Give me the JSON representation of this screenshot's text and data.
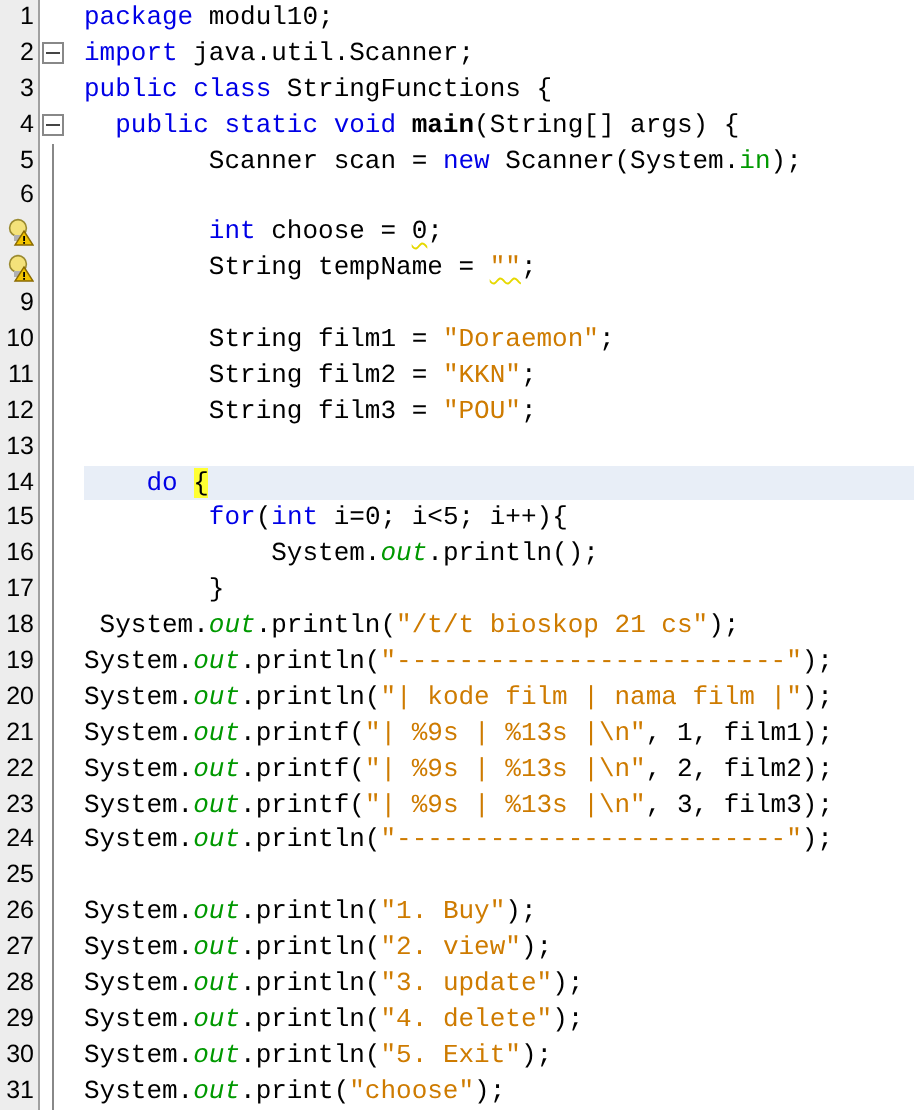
{
  "lines": [
    {
      "number": "1",
      "warning": false,
      "collapsible": false,
      "in_block": false,
      "current": false,
      "tokens": [
        {
          "text": "package",
          "kind": "keyword"
        },
        {
          "text": " modul10;",
          "kind": "plain"
        }
      ]
    },
    {
      "number": "2",
      "warning": false,
      "collapsible": true,
      "in_block": false,
      "current": false,
      "tokens": [
        {
          "text": "import",
          "kind": "keyword"
        },
        {
          "text": " java.util.Scanner;",
          "kind": "plain"
        }
      ]
    },
    {
      "number": "3",
      "warning": false,
      "collapsible": false,
      "in_block": false,
      "current": false,
      "tokens": [
        {
          "text": "public class",
          "kind": "keyword"
        },
        {
          "text": " StringFunctions {",
          "kind": "plain"
        }
      ]
    },
    {
      "number": "4",
      "warning": false,
      "collapsible": true,
      "in_block": false,
      "current": false,
      "tokens": [
        {
          "text": "  public static void ",
          "kind": "keyword"
        },
        {
          "text": "main",
          "kind": "method"
        },
        {
          "text": "(String[] args) {",
          "kind": "plain"
        }
      ]
    },
    {
      "number": "5",
      "warning": false,
      "collapsible": false,
      "in_block": true,
      "current": false,
      "tokens": [
        {
          "text": "        Scanner scan = ",
          "kind": "plain"
        },
        {
          "text": "new",
          "kind": "keyword"
        },
        {
          "text": " Scanner(System.",
          "kind": "plain"
        },
        {
          "text": "in",
          "kind": "field"
        },
        {
          "text": ");",
          "kind": "plain"
        }
      ]
    },
    {
      "number": "6",
      "warning": false,
      "collapsible": false,
      "in_block": true,
      "current": false
    },
    {
      "warning": true,
      "collapsible": false,
      "in_block": true,
      "current": false,
      "tokens": [
        {
          "text": "        int",
          "kind": "keyword"
        },
        {
          "text": " choose = ",
          "kind": "plain"
        },
        {
          "text": "0",
          "kind": "plain",
          "warn": true
        },
        {
          "text": ";",
          "kind": "plain"
        }
      ]
    },
    {
      "warning": true,
      "collapsible": false,
      "in_block": true,
      "current": false,
      "tokens": [
        {
          "text": "        String tempName = ",
          "kind": "plain"
        },
        {
          "text": "\"\"",
          "kind": "string",
          "warn": true
        },
        {
          "text": ";",
          "kind": "plain"
        }
      ]
    },
    {
      "number": "9",
      "warning": false,
      "collapsible": false,
      "in_block": true,
      "current": false
    },
    {
      "number": "10",
      "warning": false,
      "collapsible": false,
      "in_block": true,
      "current": false,
      "tokens": [
        {
          "text": "        String film1 = ",
          "kind": "plain"
        },
        {
          "text": "\"Doraemon\"",
          "kind": "string"
        },
        {
          "text": ";",
          "kind": "plain"
        }
      ]
    },
    {
      "number": "11",
      "warning": false,
      "collapsible": false,
      "in_block": true,
      "current": false,
      "tokens": [
        {
          "text": "        String film2 = ",
          "kind": "plain"
        },
        {
          "text": "\"KKN\"",
          "kind": "string"
        },
        {
          "text": ";",
          "kind": "plain"
        }
      ]
    },
    {
      "number": "12",
      "warning": false,
      "collapsible": false,
      "in_block": true,
      "current": false,
      "tokens": [
        {
          "text": "        String film3 = ",
          "kind": "plain"
        },
        {
          "text": "\"POU\"",
          "kind": "string"
        },
        {
          "text": ";",
          "kind": "plain"
        }
      ]
    },
    {
      "number": "13",
      "warning": false,
      "collapsible": false,
      "in_block": true,
      "current": false
    },
    {
      "number": "14",
      "warning": false,
      "collapsible": false,
      "in_block": true,
      "current": true,
      "tokens": [
        {
          "text": "    do ",
          "kind": "keyword"
        },
        {
          "text": "{",
          "kind": "plain",
          "matched": true
        }
      ]
    },
    {
      "number": "15",
      "warning": false,
      "collapsible": false,
      "in_block": true,
      "current": false,
      "tokens": [
        {
          "text": "        for",
          "kind": "keyword"
        },
        {
          "text": "(",
          "kind": "plain"
        },
        {
          "text": "int",
          "kind": "keyword"
        },
        {
          "text": " i=0; i<5; i++){",
          "kind": "plain"
        }
      ]
    },
    {
      "number": "16",
      "warning": false,
      "collapsible": false,
      "in_block": true,
      "current": false,
      "tokens": [
        {
          "text": "            System.",
          "kind": "plain"
        },
        {
          "text": "out",
          "kind": "static"
        },
        {
          "text": ".println();",
          "kind": "plain"
        }
      ]
    },
    {
      "number": "17",
      "warning": false,
      "collapsible": false,
      "in_block": true,
      "current": false,
      "tokens": [
        {
          "text": "        }",
          "kind": "plain"
        }
      ]
    },
    {
      "number": "18",
      "warning": false,
      "collapsible": false,
      "in_block": true,
      "current": false,
      "tokens": [
        {
          "text": " System.",
          "kind": "plain"
        },
        {
          "text": "out",
          "kind": "static"
        },
        {
          "text": ".println(",
          "kind": "plain"
        },
        {
          "text": "\"/t/t bioskop 21 cs\"",
          "kind": "string"
        },
        {
          "text": ");",
          "kind": "plain"
        }
      ]
    },
    {
      "number": "19",
      "warning": false,
      "collapsible": false,
      "in_block": true,
      "current": false,
      "tokens": [
        {
          "text": "System.",
          "kind": "plain"
        },
        {
          "text": "out",
          "kind": "static"
        },
        {
          "text": ".println(",
          "kind": "plain"
        },
        {
          "text": "\"-------------------------\"",
          "kind": "string"
        },
        {
          "text": ");",
          "kind": "plain"
        }
      ]
    },
    {
      "number": "20",
      "warning": false,
      "collapsible": false,
      "in_block": true,
      "current": false,
      "tokens": [
        {
          "text": "System.",
          "kind": "plain"
        },
        {
          "text": "out",
          "kind": "static"
        },
        {
          "text": ".println(",
          "kind": "plain"
        },
        {
          "text": "\"| kode film | nama film |\"",
          "kind": "string"
        },
        {
          "text": ");",
          "kind": "plain"
        }
      ]
    },
    {
      "number": "21",
      "warning": false,
      "collapsible": false,
      "in_block": true,
      "current": false,
      "tokens": [
        {
          "text": "System.",
          "kind": "plain"
        },
        {
          "text": "out",
          "kind": "static"
        },
        {
          "text": ".printf(",
          "kind": "plain"
        },
        {
          "text": "\"| %9s | %13s |\\n\"",
          "kind": "string"
        },
        {
          "text": ", 1, film1);",
          "kind": "plain"
        }
      ]
    },
    {
      "number": "22",
      "warning": false,
      "collapsible": false,
      "in_block": true,
      "current": false,
      "tokens": [
        {
          "text": "System.",
          "kind": "plain"
        },
        {
          "text": "out",
          "kind": "static"
        },
        {
          "text": ".printf(",
          "kind": "plain"
        },
        {
          "text": "\"| %9s | %13s |\\n\"",
          "kind": "string"
        },
        {
          "text": ", 2, film2);",
          "kind": "plain"
        }
      ]
    },
    {
      "number": "23",
      "warning": false,
      "collapsible": false,
      "in_block": true,
      "current": false,
      "tokens": [
        {
          "text": "System.",
          "kind": "plain"
        },
        {
          "text": "out",
          "kind": "static"
        },
        {
          "text": ".printf(",
          "kind": "plain"
        },
        {
          "text": "\"| %9s | %13s |\\n\"",
          "kind": "string"
        },
        {
          "text": ", 3, film3);",
          "kind": "plain"
        }
      ]
    },
    {
      "number": "24",
      "warning": false,
      "collapsible": false,
      "in_block": true,
      "current": false,
      "tokens": [
        {
          "text": "System.",
          "kind": "plain"
        },
        {
          "text": "out",
          "kind": "static"
        },
        {
          "text": ".println(",
          "kind": "plain"
        },
        {
          "text": "\"-------------------------\"",
          "kind": "string"
        },
        {
          "text": ");",
          "kind": "plain"
        }
      ]
    },
    {
      "number": "25",
      "warning": false,
      "collapsible": false,
      "in_block": true,
      "current": false
    },
    {
      "number": "26",
      "warning": false,
      "collapsible": false,
      "in_block": true,
      "current": false,
      "tokens": [
        {
          "text": "System.",
          "kind": "plain"
        },
        {
          "text": "out",
          "kind": "static"
        },
        {
          "text": ".println(",
          "kind": "plain"
        },
        {
          "text": "\"1. Buy\"",
          "kind": "string"
        },
        {
          "text": ");",
          "kind": "plain"
        }
      ]
    },
    {
      "number": "27",
      "warning": false,
      "collapsible": false,
      "in_block": true,
      "current": false,
      "tokens": [
        {
          "text": "System.",
          "kind": "plain"
        },
        {
          "text": "out",
          "kind": "static"
        },
        {
          "text": ".println(",
          "kind": "plain"
        },
        {
          "text": "\"2. view\"",
          "kind": "string"
        },
        {
          "text": ");",
          "kind": "plain"
        }
      ]
    },
    {
      "number": "28",
      "warning": false,
      "collapsible": false,
      "in_block": true,
      "current": false,
      "tokens": [
        {
          "text": "System.",
          "kind": "plain"
        },
        {
          "text": "out",
          "kind": "static"
        },
        {
          "text": ".println(",
          "kind": "plain"
        },
        {
          "text": "\"3. update\"",
          "kind": "string"
        },
        {
          "text": ");",
          "kind": "plain"
        }
      ]
    },
    {
      "number": "29",
      "warning": false,
      "collapsible": false,
      "in_block": true,
      "current": false,
      "tokens": [
        {
          "text": "System.",
          "kind": "plain"
        },
        {
          "text": "out",
          "kind": "static"
        },
        {
          "text": ".println(",
          "kind": "plain"
        },
        {
          "text": "\"4. delete\"",
          "kind": "string"
        },
        {
          "text": ");",
          "kind": "plain"
        }
      ]
    },
    {
      "number": "30",
      "warning": false,
      "collapsible": false,
      "in_block": true,
      "current": false,
      "tokens": [
        {
          "text": "System.",
          "kind": "plain"
        },
        {
          "text": "out",
          "kind": "static"
        },
        {
          "text": ".println(",
          "kind": "plain"
        },
        {
          "text": "\"5. Exit\"",
          "kind": "string"
        },
        {
          "text": ");",
          "kind": "plain"
        }
      ]
    },
    {
      "number": "31",
      "warning": false,
      "collapsible": false,
      "in_block": true,
      "current": false,
      "tokens": [
        {
          "text": "System.",
          "kind": "plain"
        },
        {
          "text": "out",
          "kind": "static"
        },
        {
          "text": ".print(",
          "kind": "plain"
        },
        {
          "text": "\"choose\"",
          "kind": "string"
        },
        {
          "text": ");",
          "kind": "plain"
        }
      ]
    }
  ]
}
